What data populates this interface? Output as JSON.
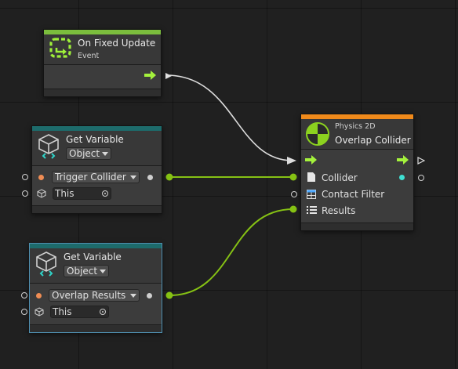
{
  "colors": {
    "event_header": "#7bbd3d",
    "variable_header": "#1d6b6b",
    "physics_header": "#f08a1b",
    "control_wire": "#dddddd",
    "value_wire": "#86c214",
    "flow_arrow": "#a4f23c"
  },
  "event_node": {
    "title": "On Fixed Update",
    "subtitle": "Event",
    "icon": "fixed-update-loop-icon"
  },
  "get_variable_1": {
    "title": "Get Variable",
    "kind_dropdown": "Object",
    "name_dropdown": "Trigger Collider",
    "object_field": "This",
    "icon": "variable-cube-icon"
  },
  "get_variable_2": {
    "title": "Get Variable",
    "kind_dropdown": "Object",
    "name_dropdown": "Overlap Results",
    "object_field": "This",
    "icon": "variable-cube-icon"
  },
  "overlap_node": {
    "category": "Physics 2D",
    "title": "Overlap Collider",
    "icon": "physics-sphere-icon",
    "ports": {
      "collider": "Collider",
      "contact_filter": "Contact Filter",
      "results": "Results"
    }
  }
}
